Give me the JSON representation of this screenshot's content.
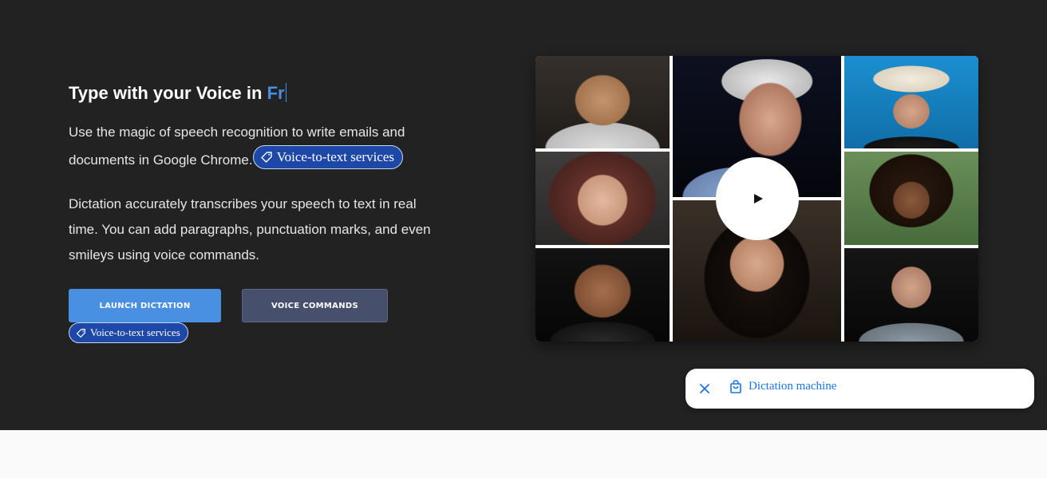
{
  "hero": {
    "heading_prefix": "Type with your Voice in ",
    "heading_language": "Fr",
    "paragraph1": "Use the magic of speech recognition to write emails and documents in Google Chrome.",
    "paragraph2": "Dictation accurately transcribes your speech to text in real time. You can add paragraphs, punctuation marks, and even smileys using voice commands.",
    "inline_tag_label": "Voice-to-text services",
    "buttons": {
      "launch_label": "LAUNCH DICTATION",
      "commands_label": "VOICE COMMANDS"
    },
    "below_button_tag_label": "Voice-to-text services"
  },
  "video": {
    "play_icon": "play-icon",
    "thumbnails": [
      "portrait-young-man",
      "portrait-elderly-man",
      "portrait-man-cowboy-hat",
      "portrait-woman-headscarf",
      "portrait-woman-curly-hair",
      "portrait-smiling-man",
      "portrait-woman-dark-hair",
      "portrait-man-hoodie"
    ]
  },
  "popup": {
    "close_icon": "close-icon",
    "link_icon": "shopping-bag-icon",
    "link_label": "Dictation machine"
  },
  "colors": {
    "hero_bg": "#222222",
    "accent": "#4a90e2",
    "secondary_button": "#46506c",
    "tag_chip": "#1d48a8",
    "popup_link": "#1a73e8",
    "lower_bg": "#fafafa"
  }
}
